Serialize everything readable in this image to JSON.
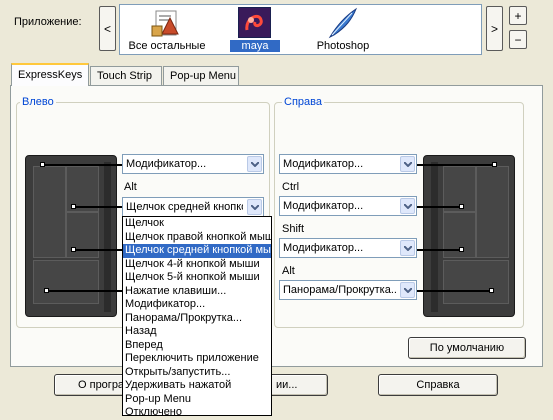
{
  "app_row": {
    "label": "Приложение:",
    "nav_left": "<",
    "nav_right": ">",
    "plus": "+",
    "minus": "−",
    "apps": [
      {
        "label": "Все остальные",
        "icon": "all-apps-icon"
      },
      {
        "label": "maya",
        "icon": "maya-icon",
        "selected": true
      },
      {
        "label": "Photoshop",
        "icon": "photoshop-feather-icon"
      }
    ]
  },
  "tabs": [
    {
      "label": "ExpressKeys",
      "active": true
    },
    {
      "label": "Touch Strip"
    },
    {
      "label": "Pop-up Menu"
    }
  ],
  "left_group": {
    "title": "Влево",
    "dropdowns": [
      {
        "value": "Модификатор...",
        "sublabel": "Alt"
      },
      {
        "value": "Щелчок средней кнопкой мыши"
      }
    ],
    "open_list": {
      "selected": "Щелчок средней кнопкой мыши",
      "items": [
        "Щелчок",
        "Щелчок правой кнопкой мыши",
        "Щелчок средней кнопкой мыши",
        "Щелчок 4-й кнопкой мыши",
        "Щелчок 5-й кнопкой мыши",
        "Нажатие клавиши...",
        "Модификатор...",
        "Панорама/Прокрутка...",
        "Назад",
        "Вперед",
        "Переключить приложение",
        "Открыть/запустить...",
        "Удерживать нажатой",
        "Pop-up Menu",
        "Отключено"
      ]
    }
  },
  "right_group": {
    "title": "Справа",
    "dropdowns": [
      {
        "value": "Модификатор...",
        "sublabel": "Ctrl"
      },
      {
        "value": "Модификатор...",
        "sublabel": "Shift"
      },
      {
        "value": "Модификатор...",
        "sublabel": "Alt"
      },
      {
        "value": "Панорама/Прокрутка..."
      }
    ]
  },
  "buttons": {
    "default": "По умолчанию",
    "about": "О програм",
    "options_tail": "ии...",
    "help": "Справка"
  },
  "colors": {
    "accent": "#0046d5",
    "selection": "#316ac5",
    "tab_highlight": "#ffc83c",
    "window_bg": "#ece9d8"
  }
}
